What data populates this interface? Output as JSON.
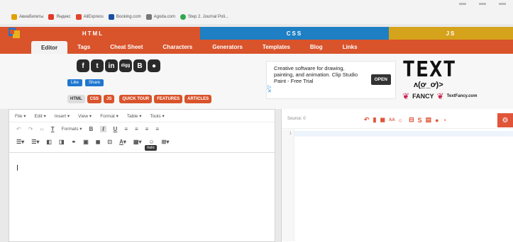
{
  "bookmarks": [
    {
      "label": "Авиабилеты",
      "color": "#e0a100"
    },
    {
      "label": "Яндекс",
      "color": "#e03a2b"
    },
    {
      "label": "AliExpress",
      "color": "#e0442b"
    },
    {
      "label": "Booking.com",
      "color": "#1b4fa3"
    },
    {
      "label": "Agoda.com",
      "color": "#777777"
    },
    {
      "label": "Step 2. Journal Poli...",
      "color": "#2fa84f"
    }
  ],
  "sections": {
    "html": "HTML",
    "css": "CSS",
    "js": "JS"
  },
  "nav": [
    "Editor",
    "Tags",
    "Cheat Sheet",
    "Characters",
    "Generators",
    "Templates",
    "Blog",
    "Links"
  ],
  "social": {
    "like": "Like",
    "share": "Share"
  },
  "subtabs": [
    {
      "label": "HTML",
      "color": "#dddddd"
    },
    {
      "label": "CSS",
      "color": "#d9532b"
    },
    {
      "label": "JS",
      "color": "#d9532b"
    },
    {
      "label": "QUICK TOUR",
      "color": "#d9532b"
    },
    {
      "label": "FEATURES",
      "color": "#d9532b"
    },
    {
      "label": "ARTICLES",
      "color": "#d9532b"
    }
  ],
  "ad": {
    "text": "Creative software for drawing, painting, and animation. Clip Studio Paint - Free Trial",
    "button": "OPEN"
  },
  "textlogo": {
    "big": "TEXT",
    "face": "ʌ(ơ̲_ơ)>",
    "fancy": "FANCY",
    "site": "TextFancy.com"
  },
  "editor": {
    "menu": [
      "File ▾",
      "Edit ▾",
      "Insert ▾",
      "View ▾",
      "Format ▾",
      "Table ▾",
      "Tools ▾"
    ],
    "formats": "Formats ▾",
    "tooltip": "Italic"
  },
  "source": {
    "label": "Source: 0",
    "line": "1"
  }
}
